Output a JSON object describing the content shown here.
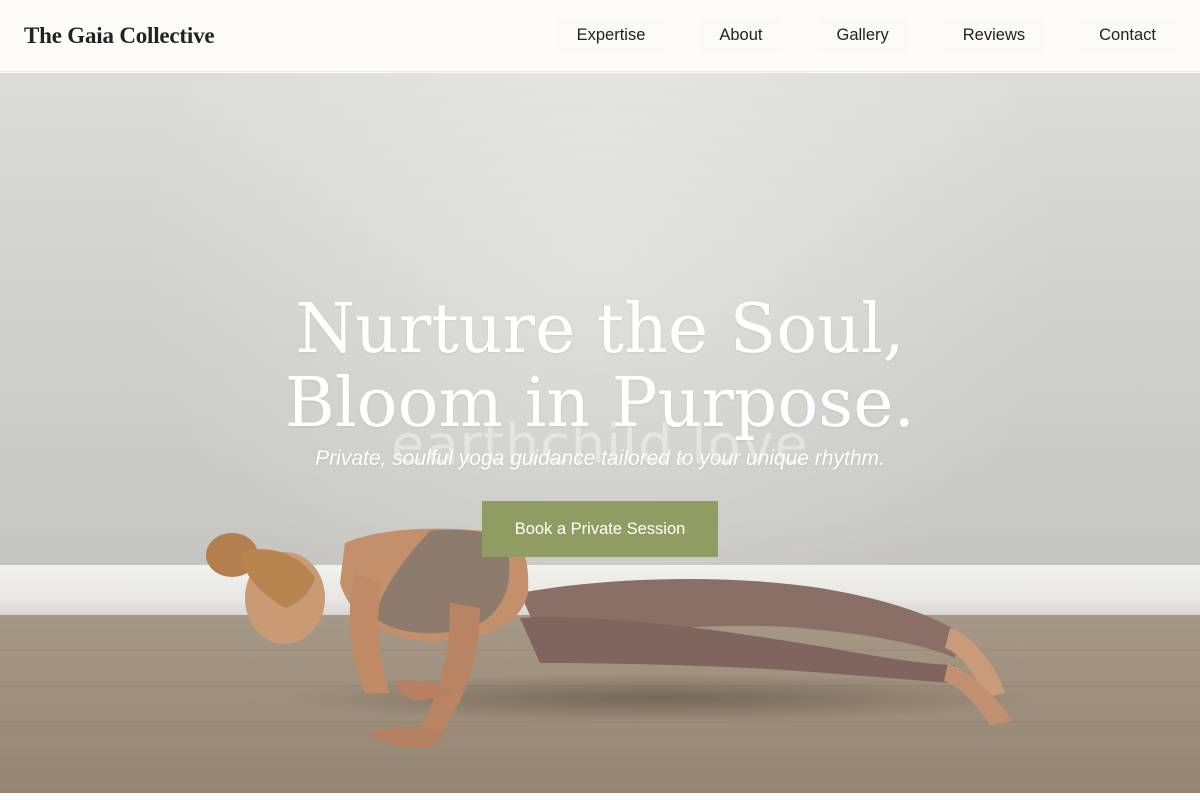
{
  "header": {
    "brand": "The Gaia Collective",
    "nav": [
      {
        "label": "Expertise"
      },
      {
        "label": "About"
      },
      {
        "label": "Gallery"
      },
      {
        "label": "Reviews"
      },
      {
        "label": "Contact"
      }
    ]
  },
  "hero": {
    "title_line1": "Nurture the Soul,",
    "title_line2": "Bloom in Purpose.",
    "watermark": "earthchild.love",
    "subtitle": "Private, soulful yoga guidance tailored to your unique rhythm.",
    "cta_label": "Book a Private Session"
  },
  "colors": {
    "accent": "#8f9d63",
    "header_bg": "#fdfcf7",
    "text_dark": "#222222"
  }
}
